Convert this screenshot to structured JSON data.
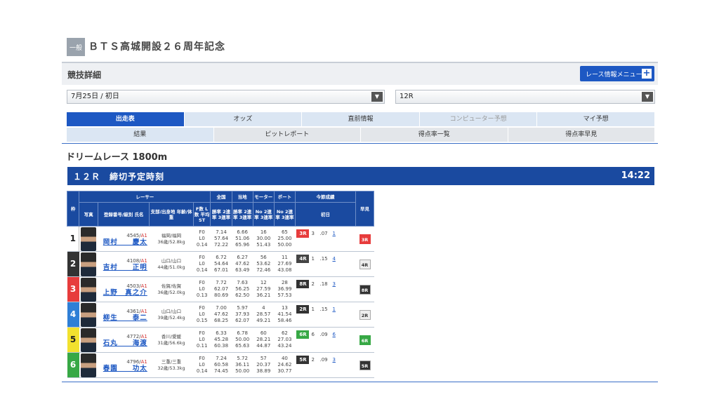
{
  "header": {
    "badge": "一般",
    "title": "ＢＴＳ高城開設２６周年記念"
  },
  "section": {
    "title": "競技詳細",
    "menu_button": "レース情報メニュー",
    "menu_plus": "+"
  },
  "selectors": {
    "date": "7月25日 / 初日",
    "race": "12R",
    "arrow": "▼"
  },
  "tabs_row1": [
    "出走表",
    "オッズ",
    "直前情報",
    "コンピューター予想",
    "マイ予想"
  ],
  "tabs_row2": [
    "結果",
    "ピットレポート",
    "得点率一覧",
    "得点率早見"
  ],
  "race": {
    "name": "ドリームレース 1800m",
    "label": "１２Ｒ　締切予定時刻",
    "deadline": "14:22"
  },
  "table_headers": {
    "waku": "枠",
    "racer": "レーサー",
    "national": "全国",
    "local": "当地",
    "motor": "モーター",
    "boat": "ボート",
    "session": "今節成績",
    "early": "早見",
    "photo": "写真",
    "reg_name": "登録番号/級別 氏名",
    "branch": "支部/出身地 年齢/体重",
    "fl": "F数 L数 平均ST",
    "win_nat": "勝率 2連率 3連率",
    "win_loc": "勝率 2連率 3連率",
    "motor_no": "No 2連率 3連率",
    "boat_no": "No 2連率 3連率",
    "day1": "初日"
  },
  "racers": [
    {
      "waku": "1",
      "reg": "4545/",
      "cls": "A1",
      "name": "岡村　　慶太",
      "branch": "福岡/福岡",
      "age": "36歳/52.8kg",
      "f": "F0",
      "l": "L0",
      "st": "0.14",
      "n1": "7.14",
      "n2": "57.64",
      "n3": "72.22",
      "c1": "6.66",
      "c2": "51.06",
      "c3": "65.96",
      "m1": "16",
      "m2": "30.00",
      "m3": "51.43",
      "b1": "65",
      "b2": "25.00",
      "b3": "50.00",
      "rk": "3R",
      "lane": "3",
      "stv": ".07",
      "pos": "1",
      "early": "3R"
    },
    {
      "waku": "2",
      "reg": "4108/",
      "cls": "A1",
      "name": "吉村　　正明",
      "branch": "山口/山口",
      "age": "44歳/51.0kg",
      "f": "F0",
      "l": "L0",
      "st": "0.14",
      "n1": "6.72",
      "n2": "54.64",
      "n3": "67.01",
      "c1": "6.27",
      "c2": "47.62",
      "c3": "63.49",
      "m1": "56",
      "m2": "53.62",
      "m3": "72.46",
      "b1": "11",
      "b2": "27.69",
      "b3": "43.08",
      "rk": "4R",
      "lane": "1",
      "stv": ".15",
      "pos": "4",
      "early": "4R"
    },
    {
      "waku": "3",
      "reg": "4503/",
      "cls": "A1",
      "name": "上野　真之介",
      "branch": "佐賀/佐賀",
      "age": "36歳/52.0kg",
      "f": "F0",
      "l": "L0",
      "st": "0.13",
      "n1": "7.72",
      "n2": "62.07",
      "n3": "80.69",
      "c1": "7.63",
      "c2": "56.25",
      "c3": "62.50",
      "m1": "12",
      "m2": "27.59",
      "m3": "36.21",
      "b1": "28",
      "b2": "36.99",
      "b3": "57.53",
      "rk": "8R",
      "lane": "2",
      "stv": ".18",
      "pos": "3",
      "early": "8R"
    },
    {
      "waku": "4",
      "reg": "4361/",
      "cls": "A1",
      "name": "柳生　　泰二",
      "branch": "山口/山口",
      "age": "39歳/52.4kg",
      "f": "F0",
      "l": "L0",
      "st": "0.15",
      "n1": "7.00",
      "n2": "47.62",
      "n3": "68.25",
      "c1": "5.97",
      "c2": "37.93",
      "c3": "62.07",
      "m1": "4",
      "m2": "28.57",
      "m3": "49.21",
      "b1": "13",
      "b2": "41.54",
      "b3": "58.46",
      "rk": "2R",
      "lane": "1",
      "stv": ".15",
      "pos": "1",
      "early": "2R"
    },
    {
      "waku": "5",
      "reg": "4772/",
      "cls": "A1",
      "name": "石丸　　海渡",
      "branch": "香川/愛媛",
      "age": "31歳/56.6kg",
      "f": "F0",
      "l": "L0",
      "st": "0.11",
      "n1": "6.33",
      "n2": "45.28",
      "n3": "60.38",
      "c1": "6.78",
      "c2": "50.00",
      "c3": "65.63",
      "m1": "60",
      "m2": "28.21",
      "m3": "44.87",
      "b1": "62",
      "b2": "27.03",
      "b3": "43.24",
      "rk": "6R",
      "lane": "6",
      "stv": ".09",
      "pos": "6",
      "early": "6R"
    },
    {
      "waku": "6",
      "reg": "4796/",
      "cls": "A1",
      "name": "春園　　功太",
      "branch": "三重/三重",
      "age": "32歳/53.3kg",
      "f": "F0",
      "l": "L0",
      "st": "0.14",
      "n1": "7.24",
      "n2": "60.58",
      "n3": "74.45",
      "c1": "5.72",
      "c2": "36.11",
      "c3": "50.00",
      "m1": "57",
      "m2": "20.37",
      "m3": "38.89",
      "b1": "40",
      "b2": "24.62",
      "b3": "30.77",
      "rk": "5R",
      "lane": "2",
      "stv": ".09",
      "pos": "3",
      "early": "5R"
    }
  ]
}
